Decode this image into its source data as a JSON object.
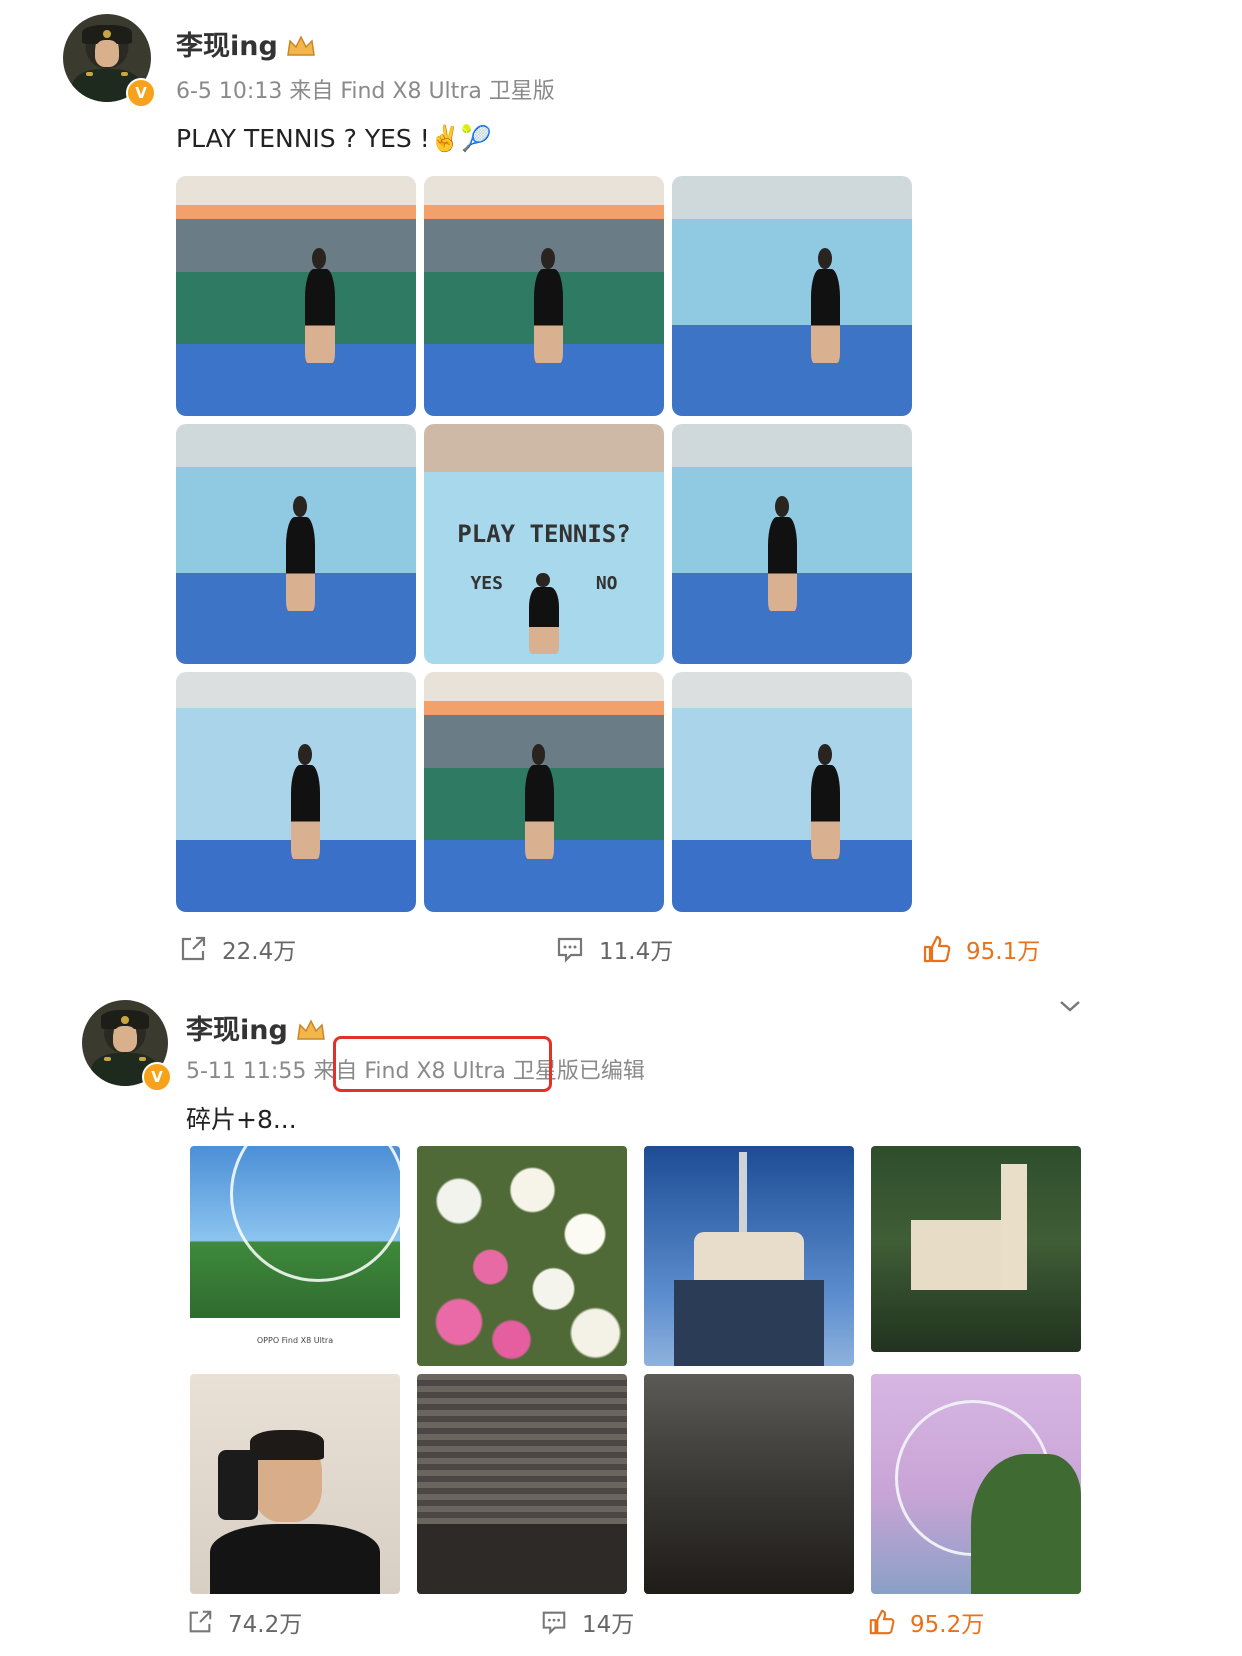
{
  "post1": {
    "author": "李现ing",
    "meta": "6-5 10:13 来自 Find X8 Ultra 卫星版",
    "text": "PLAY TENNIS ? YES !✌️🎾",
    "wall_text": "PLAY TENNIS?",
    "wall_yes": "YES",
    "wall_no": "NO",
    "photo_count": 9,
    "actions": {
      "share_count": "22.4万",
      "comment_count": "11.4万",
      "like_count": "95.1万"
    }
  },
  "post2": {
    "author": "李现ing",
    "meta_date": "5-11 11:55",
    "meta_from": "来自",
    "meta_device": "Find X8 Ultra 卫星版",
    "meta_edited": "已编辑",
    "text": "碎片+8...",
    "photo_caption": "OPPO Find X8 Ultra",
    "photo_count": 8,
    "actions": {
      "share_count": "74.2万",
      "comment_count": "14万",
      "like_count": "95.2万"
    }
  },
  "icons": {
    "verified": "V",
    "share": "share-icon",
    "comment": "comment-icon",
    "like": "thumbs-up-icon",
    "chevron": "chevron-down-icon"
  },
  "colors": {
    "accent": "#e8711b",
    "verified": "#f7a21b",
    "highlight_box": "#e0312b"
  }
}
